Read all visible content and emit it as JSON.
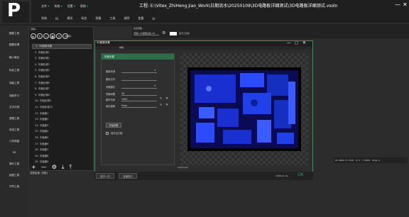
{
  "app": {
    "logo": "P",
    "title": "工程: E:\\Vitex_ZhiHeng.Jiao_Work\\日期流水\\20250109\\3D电路板详细测试\\3D电路板详细测试.vsoln",
    "top_menus": [
      "文件",
      "系统",
      "设置",
      "帮助"
    ],
    "menubar": [
      "系统",
      "IO",
      "通讯",
      "标定",
      "测量",
      "工具",
      "说明",
      "变量",
      "UI"
    ],
    "win_min": "—",
    "win_close": "✕"
  },
  "sidebar": {
    "items": [
      "图像工具",
      "图像处理",
      "输入输出",
      "标定工具",
      "测量工具",
      "深度学习",
      "文字识别",
      "逻辑工具",
      "系统工具",
      "几何测量",
      "3D",
      "简约工具",
      "绘图工具",
      "字符工具"
    ]
  },
  "flow": {
    "header": "流程1",
    "controls_label": "流程1",
    "items": [
      "1. 3D图像采集",
      "2. 平面区域1",
      "3. 平面区域2",
      "4. 平面区域3",
      "5. 平面区域4",
      "6. 平面区域5",
      "7. 平面区域6",
      "8. 平面区域7",
      "9. 平面区域8",
      "10. 平面区域9",
      "11. 平面区域10",
      "12. 平面度1",
      "13. 平面度2",
      "14. 平面度3",
      "15. 平面度4",
      "16. 平面度5",
      "17. 平面度6",
      "18. 平面度7",
      "19. 平面度8",
      "20. 平面度9"
    ],
    "status": "流程结束: 流程1",
    "tools": [
      "+",
      "—",
      "⚙",
      "⤓",
      "⤒"
    ]
  },
  "right_top": {
    "label1": "设置流程",
    "camera": "流程1.3D图像采集.3D",
    "display_label": "显示工具条"
  },
  "dialog": {
    "title": "3D图像采集",
    "tab": "参数",
    "section": "采集设置",
    "props": [
      {
        "label": "图像来源",
        "value": "",
        "dropdown": true
      },
      {
        "label": "图像文件",
        "value": "",
        "dropdown": false
      },
      {
        "label": "采集模式",
        "value": "",
        "dropdown": true
      },
      {
        "label": "采集间隔",
        "value": "30",
        "dropdown": false
      },
      {
        "label": "超时时间",
        "value": "1000",
        "dropdown": false
      },
      {
        "label": "保存图像",
        "value": "False",
        "dropdown": false
      }
    ],
    "trigger": "开始采集",
    "checkbox_label": "保存运行图",
    "status": "depth/rgb"
  },
  "bottom": {
    "run_once": "执行一次",
    "run_loop": "连续执行",
    "time": "2008.11 ms",
    "ok": "OK"
  },
  "readout": {
    "coords": "W: 2640, H: 1720",
    "x": "X: 0",
    "y": "Y: 1000",
    "gray": "Gray: 0"
  }
}
